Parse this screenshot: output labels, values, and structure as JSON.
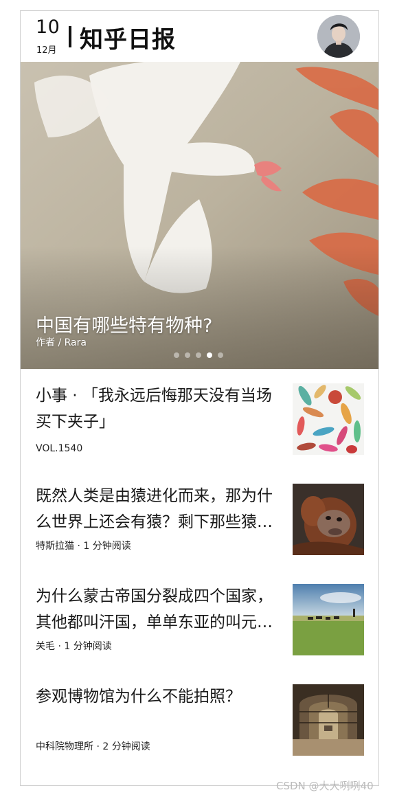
{
  "header": {
    "day": "10",
    "month": "12月",
    "app_title": "知乎日报"
  },
  "hero": {
    "title": "中国有哪些特有物种?",
    "author": "作者 / Rara",
    "active_slide": 4,
    "slide_count": 5
  },
  "stories": [
    {
      "title": "小事 · 「我永远后悔那天没有当场买下夹子」",
      "meta": "VOL.1540"
    },
    {
      "title": "既然人类是由猿进化而来，那为什么世界上还会有猿？剩下那些猿为什么没有进化？",
      "meta": "特斯拉猫 · 1 分钟阅读"
    },
    {
      "title": "为什么蒙古帝国分裂成四个国家，其他都叫汗国，单单东亚的叫元朝？",
      "meta": "关毛 · 1 分钟阅读"
    },
    {
      "title": "参观博物馆为什么不能拍照？",
      "meta": "中科院物理所 · 2 分钟阅读"
    }
  ],
  "watermark": "CSDN @大大咧咧40"
}
